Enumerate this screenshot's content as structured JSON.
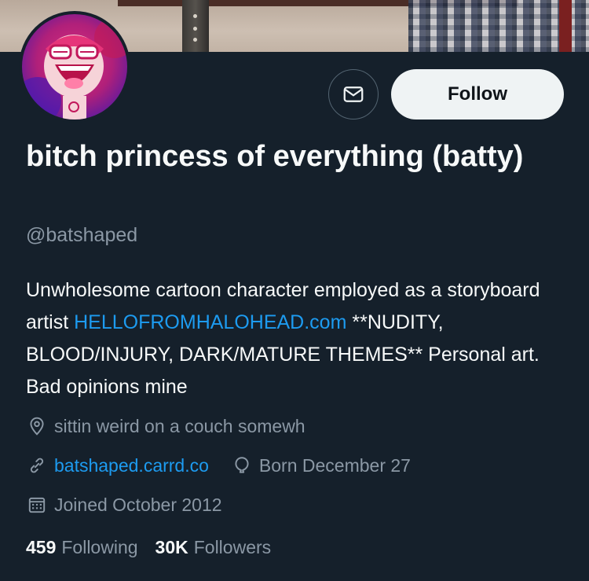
{
  "profile": {
    "display_name": "bitch princess of everything (batty)",
    "handle": "@batshaped",
    "bio_before_link": "Unwholesome cartoon character employed as a storyboard artist ",
    "bio_link": "HELLOFROMHALOHEAD.com",
    "bio_after_link": " **NUDITY, BLOOD/INJURY, DARK/MATURE THEMES** Personal art. Bad opinions mine",
    "location": "sittin weird on a couch somewh",
    "website": "batshaped.carrd.co",
    "birthday": "Born December 27",
    "joined": "Joined October 2012"
  },
  "actions": {
    "message_icon": "envelope-icon",
    "follow_label": "Follow"
  },
  "stats": {
    "following_count": "459",
    "following_label": "Following",
    "followers_count": "30K",
    "followers_label": "Followers"
  },
  "colors": {
    "background": "#15202b",
    "text_primary": "#f7f9f9",
    "text_secondary": "#8b98a5",
    "link": "#1d9bf0",
    "button_bg": "#eff3f4"
  }
}
